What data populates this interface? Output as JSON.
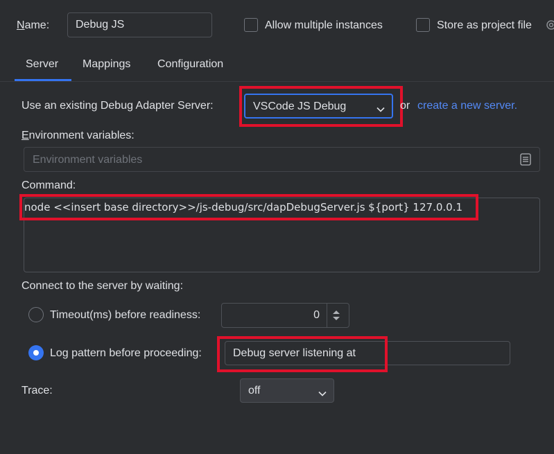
{
  "header": {
    "name_label_mnemonic": "N",
    "name_label_rest": "ame:",
    "name_value": "Debug JS",
    "allow_multiple_label": "Allow multiple instances",
    "store_project_label": "Store as project file"
  },
  "tabs": [
    {
      "label": "Server",
      "selected": true
    },
    {
      "label": "Mappings",
      "selected": false
    },
    {
      "label": "Configuration",
      "selected": false
    }
  ],
  "server": {
    "use_existing_label": "Use an existing Debug Adapter Server:",
    "server_select_value": "VSCode JS Debug",
    "or_text": "or",
    "create_link": "create a new server.",
    "env_label_mnemonic": "E",
    "env_label_rest": "nvironment variables:",
    "env_placeholder": "Environment variables",
    "command_label": "Command:",
    "command_value": "node <<insert base directory>>/js-debug/src/dapDebugServer.js ${port} 127.0.0.1",
    "connect_label": "Connect to the server by waiting:",
    "timeout_label": "Timeout(ms) before readiness:",
    "timeout_value": "0",
    "log_pattern_label": "Log pattern before proceeding:",
    "log_pattern_value": "Debug server listening at",
    "trace_label": "Trace:",
    "trace_value": "off"
  },
  "colors": {
    "background": "#2b2d30",
    "accent": "#3574f0",
    "link": "#548af7",
    "highlight": "#e0112b"
  }
}
